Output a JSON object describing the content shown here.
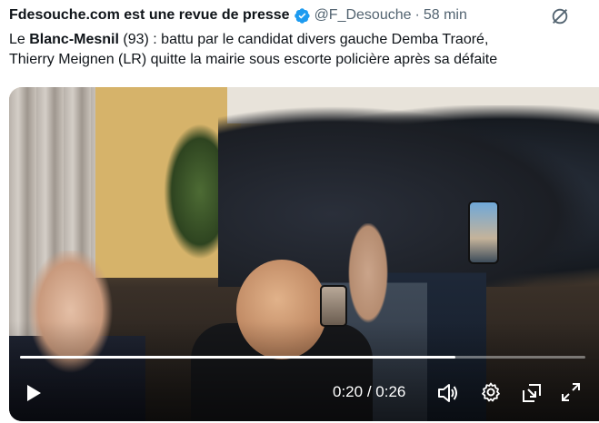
{
  "tweet": {
    "author_name": "Fdesouche.com est une revue de presse",
    "handle": "@F_Desouche",
    "separator": "·",
    "time": "58 min",
    "verified": true,
    "text": {
      "part1": "Le ",
      "bold": "Blanc-Mesnil",
      "part2": " (93) : battu par le candidat divers gauche Demba Traoré,",
      "line2": "Thierry Meignen (LR) quitte la mairie sous escorte policière après sa défaite"
    }
  },
  "video": {
    "current_time": "0:20",
    "duration_sep": " / ",
    "duration": "0:26",
    "progress": 0.77
  },
  "icons": {
    "verified": "verified-badge-icon",
    "grok": "grok-icon",
    "play": "play-icon",
    "volume": "volume-icon",
    "settings": "gear-icon",
    "pip": "picture-in-picture-icon",
    "fullscreen": "fullscreen-icon"
  },
  "colors": {
    "verified_blue": "#1d9bf0",
    "secondary_text": "#536471",
    "primary_text": "#0f1419"
  }
}
